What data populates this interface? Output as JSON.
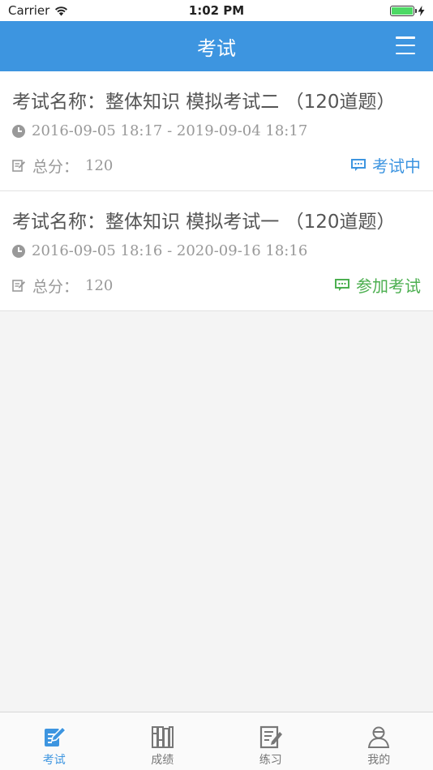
{
  "status_bar": {
    "carrier": "Carrier",
    "time": "1:02 PM"
  },
  "header": {
    "title": "考试"
  },
  "exams": [
    {
      "title": "考试名称：整体知识 模拟考试二 （120道题）",
      "time_range": "2016-09-05 18:17 - 2019-09-04 18:17",
      "score_label": "总分：",
      "score_value": "120",
      "status": "考试中",
      "status_color": "#3d95e0"
    },
    {
      "title": "考试名称：整体知识 模拟考试一 （120道题）",
      "time_range": "2016-09-05 18:16 - 2020-09-16 18:16",
      "score_label": "总分：",
      "score_value": "120",
      "status": "参加考试",
      "status_color": "#4caf50"
    }
  ],
  "tabs": [
    {
      "label": "考试",
      "icon": "exam-icon",
      "active": true
    },
    {
      "label": "成绩",
      "icon": "books-icon",
      "active": false
    },
    {
      "label": "练习",
      "icon": "notebook-icon",
      "active": false
    },
    {
      "label": "我的",
      "icon": "profile-icon",
      "active": false
    }
  ],
  "colors": {
    "accent": "#3d95e0",
    "inactive": "#777777",
    "join": "#4caf50"
  }
}
